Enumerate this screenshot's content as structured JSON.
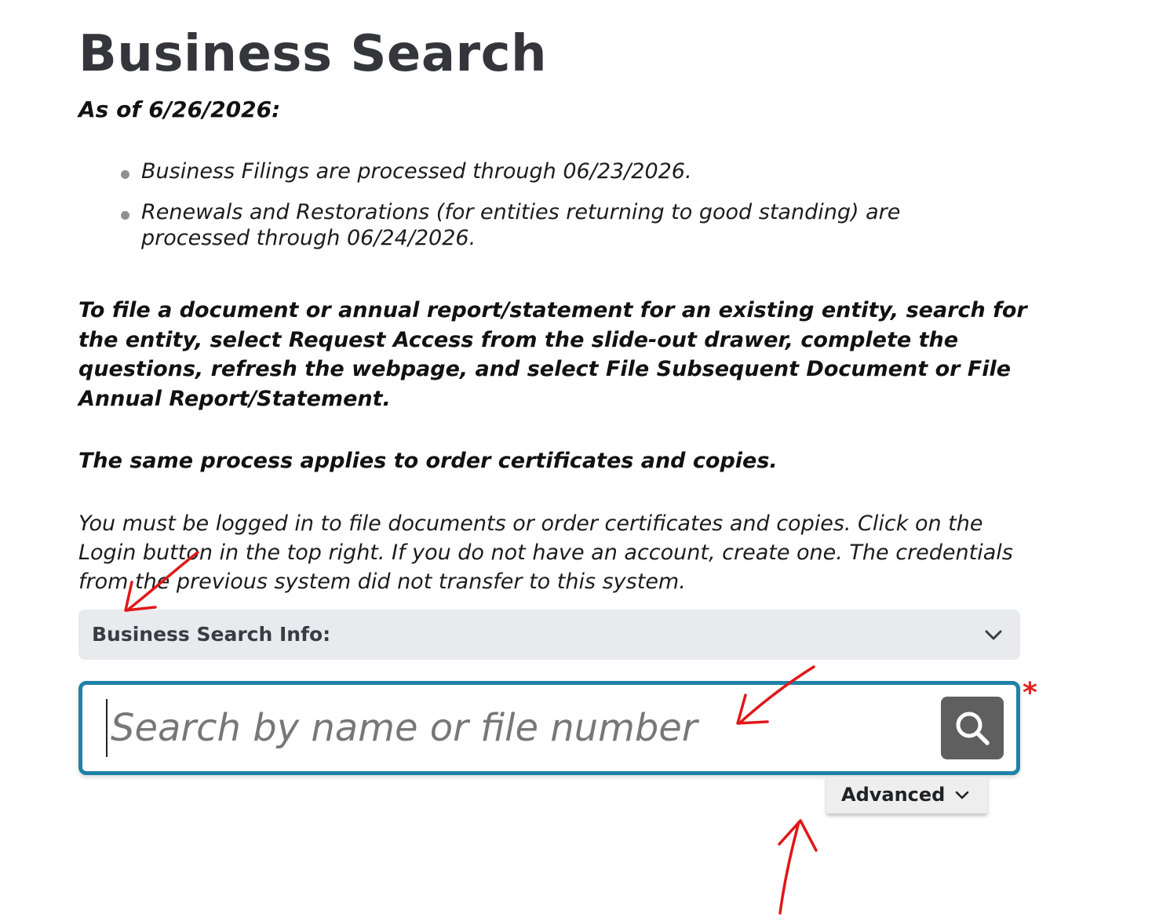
{
  "page": {
    "title": "Business Search",
    "as_of": "As of 6/26/2026:"
  },
  "status_items": [
    "Business Filings are processed through 06/23/2026.",
    "Renewals and Restorations (for entities returning to good standing) are processed through 06/24/2026."
  ],
  "instructions": "To file a document or annual report/statement for an existing entity, search for the entity, select Request Access from the slide-out drawer, complete the questions, refresh the webpage, and select File Subsequent Document or File Annual Report/Statement.",
  "process_note": "The same process applies to order certificates and copies.",
  "login_note": "You must be logged in to file documents or order certificates and copies. Click on the Login button in the top right. If you do not have an account, create one. The credentials from the previous system did not transfer to this system.",
  "accordion": {
    "label": "Business Search Info:",
    "icon": "chevron-down-icon"
  },
  "search": {
    "placeholder": "Search by name or file number",
    "value": "",
    "required_mark": "*",
    "button_icon": "search-icon"
  },
  "advanced": {
    "label": "Advanced",
    "icon": "chevron-down-icon"
  },
  "colors": {
    "search_border": "#1e82a6",
    "search_button": "#5f5f5f",
    "required": "#e02020",
    "annotation_arrows": "#e01818",
    "accordion_bg": "#e9eaee"
  }
}
